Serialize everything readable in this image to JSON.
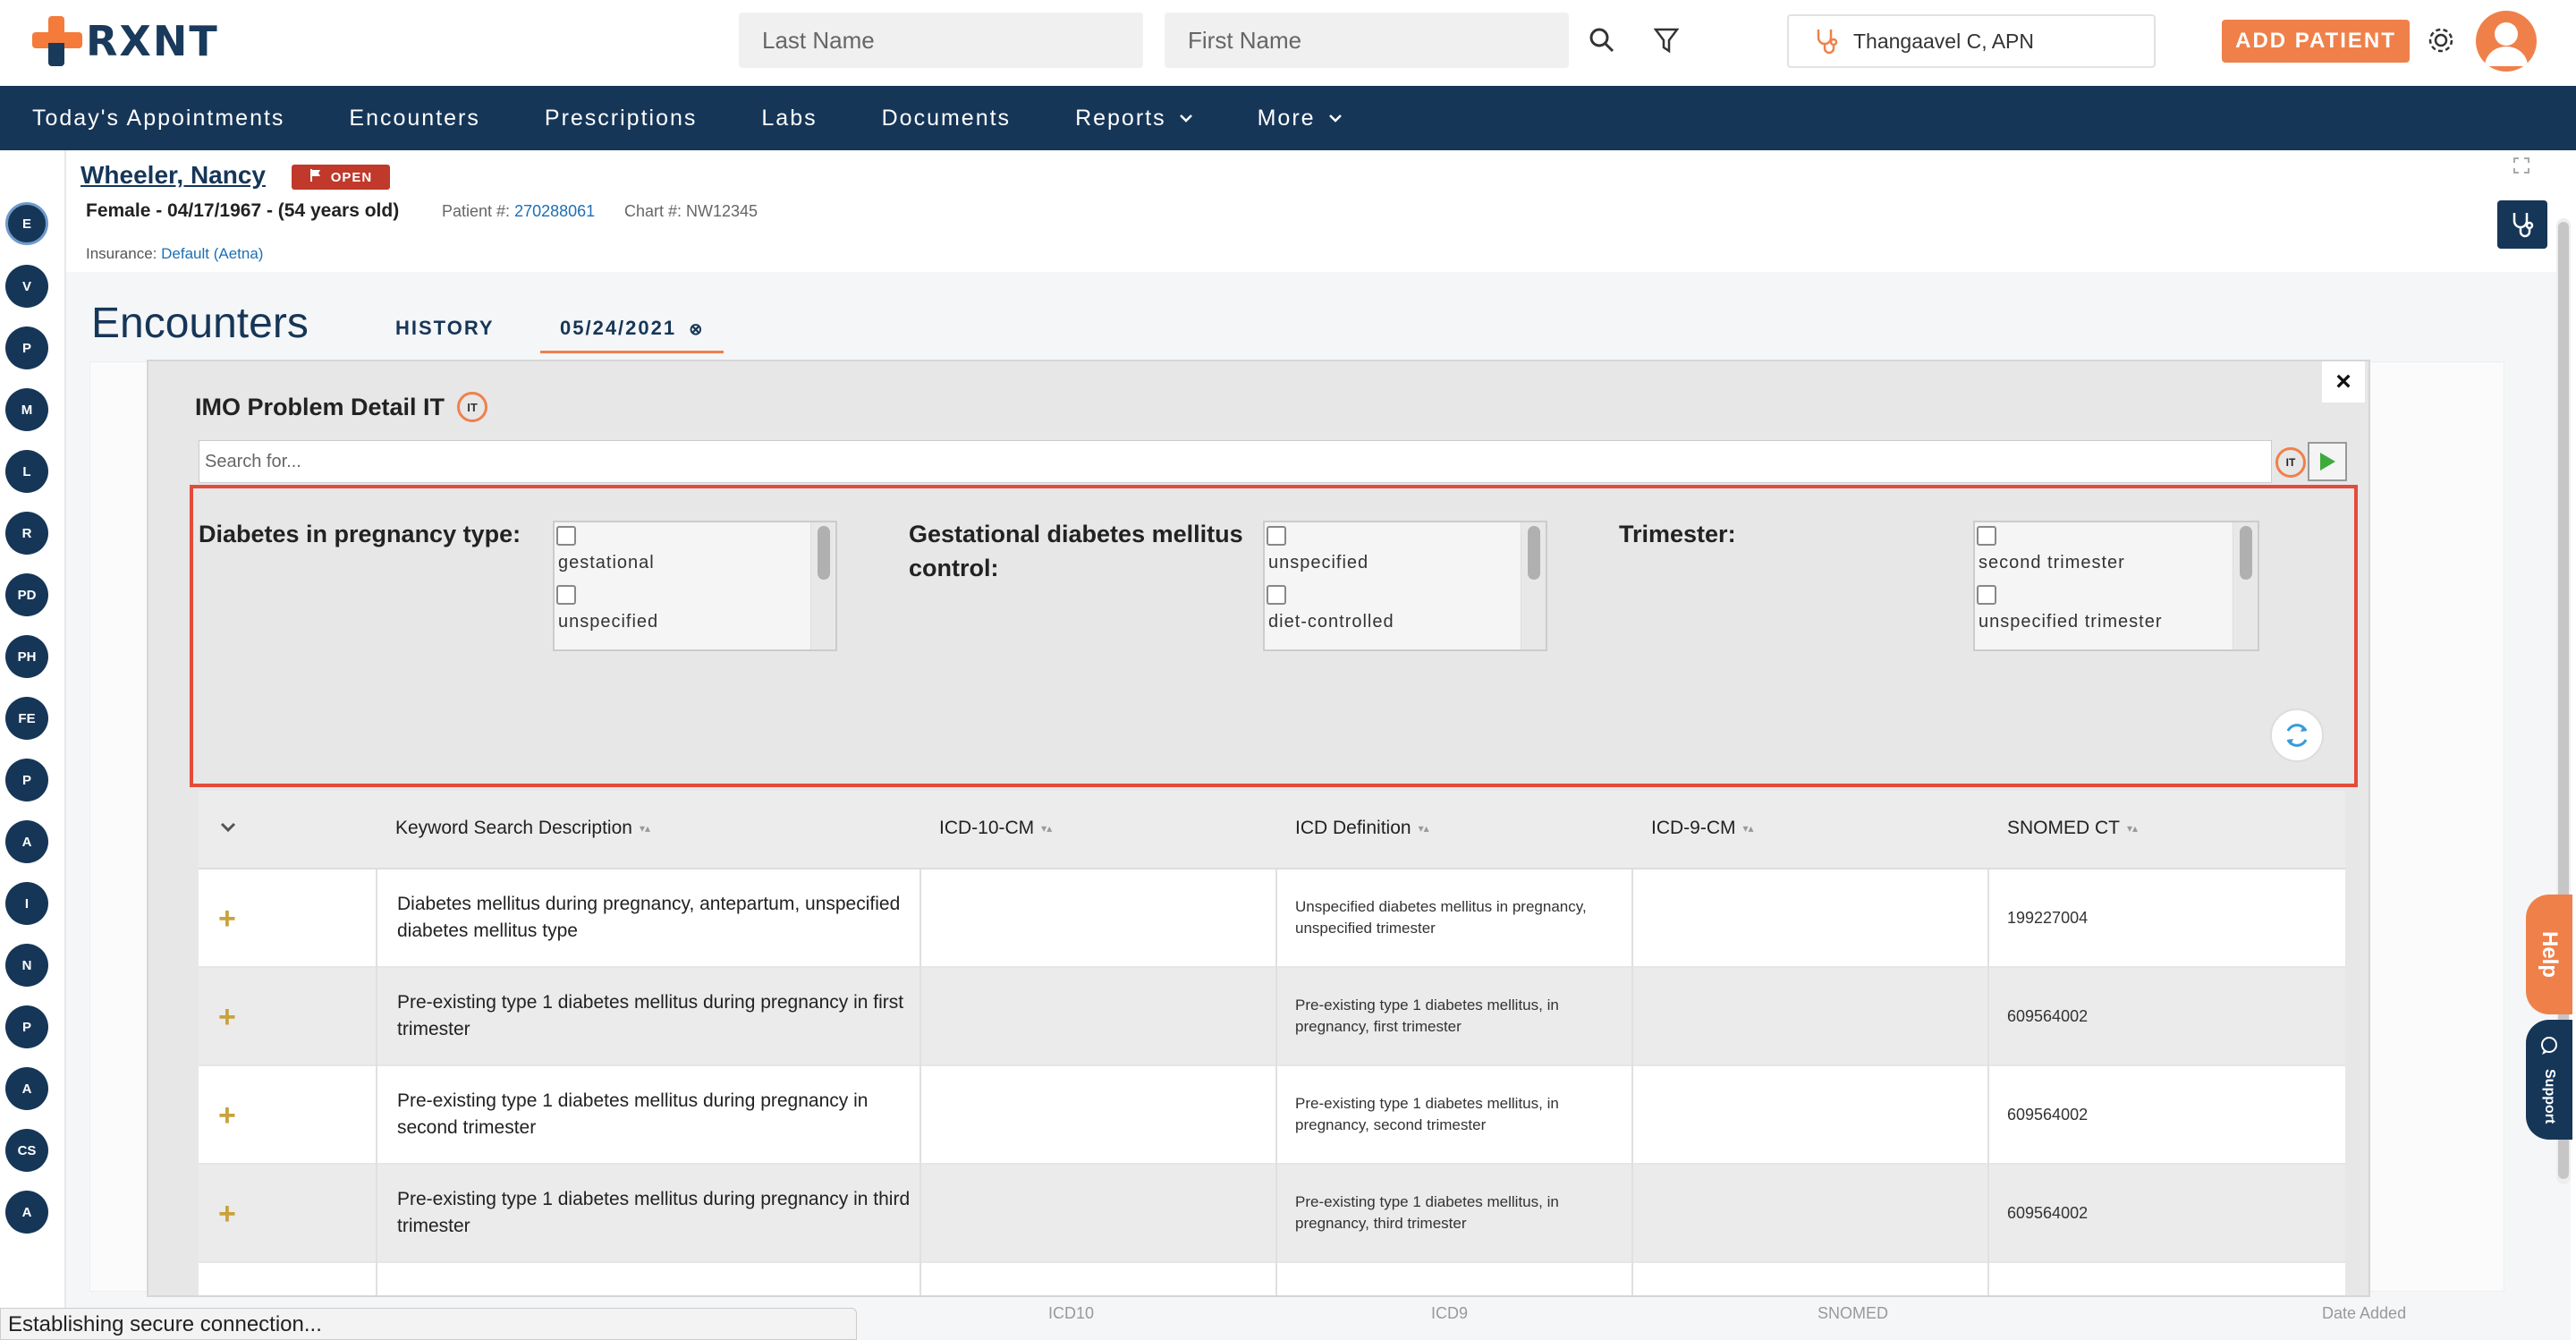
{
  "header": {
    "logo_text": "RXNT",
    "last_name_placeholder": "Last Name",
    "first_name_placeholder": "First Name",
    "provider": "Thangaavel C, APN",
    "add_patient": "ADD PATIENT"
  },
  "nav": {
    "items": [
      {
        "label": "Today's Appointments"
      },
      {
        "label": "Encounters"
      },
      {
        "label": "Prescriptions"
      },
      {
        "label": "Labs"
      },
      {
        "label": "Documents"
      },
      {
        "label": "Reports"
      },
      {
        "label": "More"
      }
    ]
  },
  "sidebar_circles": [
    "E",
    "V",
    "P",
    "M",
    "L",
    "R",
    "PD",
    "PH",
    "FE",
    "P",
    "A",
    "I",
    "N",
    "P",
    "A",
    "CS",
    "A"
  ],
  "patient": {
    "name": "Wheeler, Nancy",
    "status": "OPEN",
    "demographics": "Female - 04/17/1967 - (54 years old)",
    "patient_label": "Patient #:",
    "patient_number": "270288061",
    "chart_label": "Chart #: NW12345",
    "insurance_label": "Insurance:",
    "insurance_value": "Default (Aetna)"
  },
  "encounters": {
    "title": "Encounters",
    "tab_history": "HISTORY",
    "tab_date": "05/24/2021"
  },
  "modal": {
    "title": "IMO Problem Detail IT",
    "it_logo": "IT",
    "search_placeholder": "Search for...",
    "filters": [
      {
        "label": "Diabetes in pregnancy type:",
        "options": [
          "gestational",
          "unspecified"
        ]
      },
      {
        "label": "Gestational diabetes mellitus control:",
        "options": [
          "unspecified",
          "diet-controlled"
        ]
      },
      {
        "label": "Trimester:",
        "options": [
          "second trimester",
          "unspecified trimester"
        ]
      }
    ],
    "table": {
      "headers": [
        "Keyword Search Description",
        "ICD-10-CM",
        "ICD Definition",
        "ICD-9-CM",
        "SNOMED CT"
      ],
      "rows": [
        {
          "desc": "Diabetes mellitus during pregnancy, antepartum, unspecified diabetes mellitus type",
          "def": "Unspecified diabetes mellitus in pregnancy, unspecified trimester",
          "snomed": "199227004"
        },
        {
          "desc": "Pre-existing type 1 diabetes mellitus during pregnancy in first trimester",
          "def": "Pre-existing type 1 diabetes mellitus, in pregnancy, first trimester",
          "snomed": "609564002"
        },
        {
          "desc": "Pre-existing type 1 diabetes mellitus during pregnancy in second trimester",
          "def": "Pre-existing type 1 diabetes mellitus, in pregnancy, second trimester",
          "snomed": "609564002"
        },
        {
          "desc": "Pre-existing type 1 diabetes mellitus during pregnancy in third trimester",
          "def": "Pre-existing type 1 diabetes mellitus, in pregnancy, third trimester",
          "snomed": "609564002"
        }
      ]
    }
  },
  "right_tabs": {
    "help": "Help",
    "support": "Support"
  },
  "status_bar": "Establishing secure connection...",
  "bottom_columns": [
    "ICD10",
    "ICD9",
    "SNOMED",
    "Date Added"
  ],
  "colors": {
    "brand_navy": "#163658",
    "accent_orange": "#f0804a",
    "highlight_red": "#e34b3b"
  }
}
